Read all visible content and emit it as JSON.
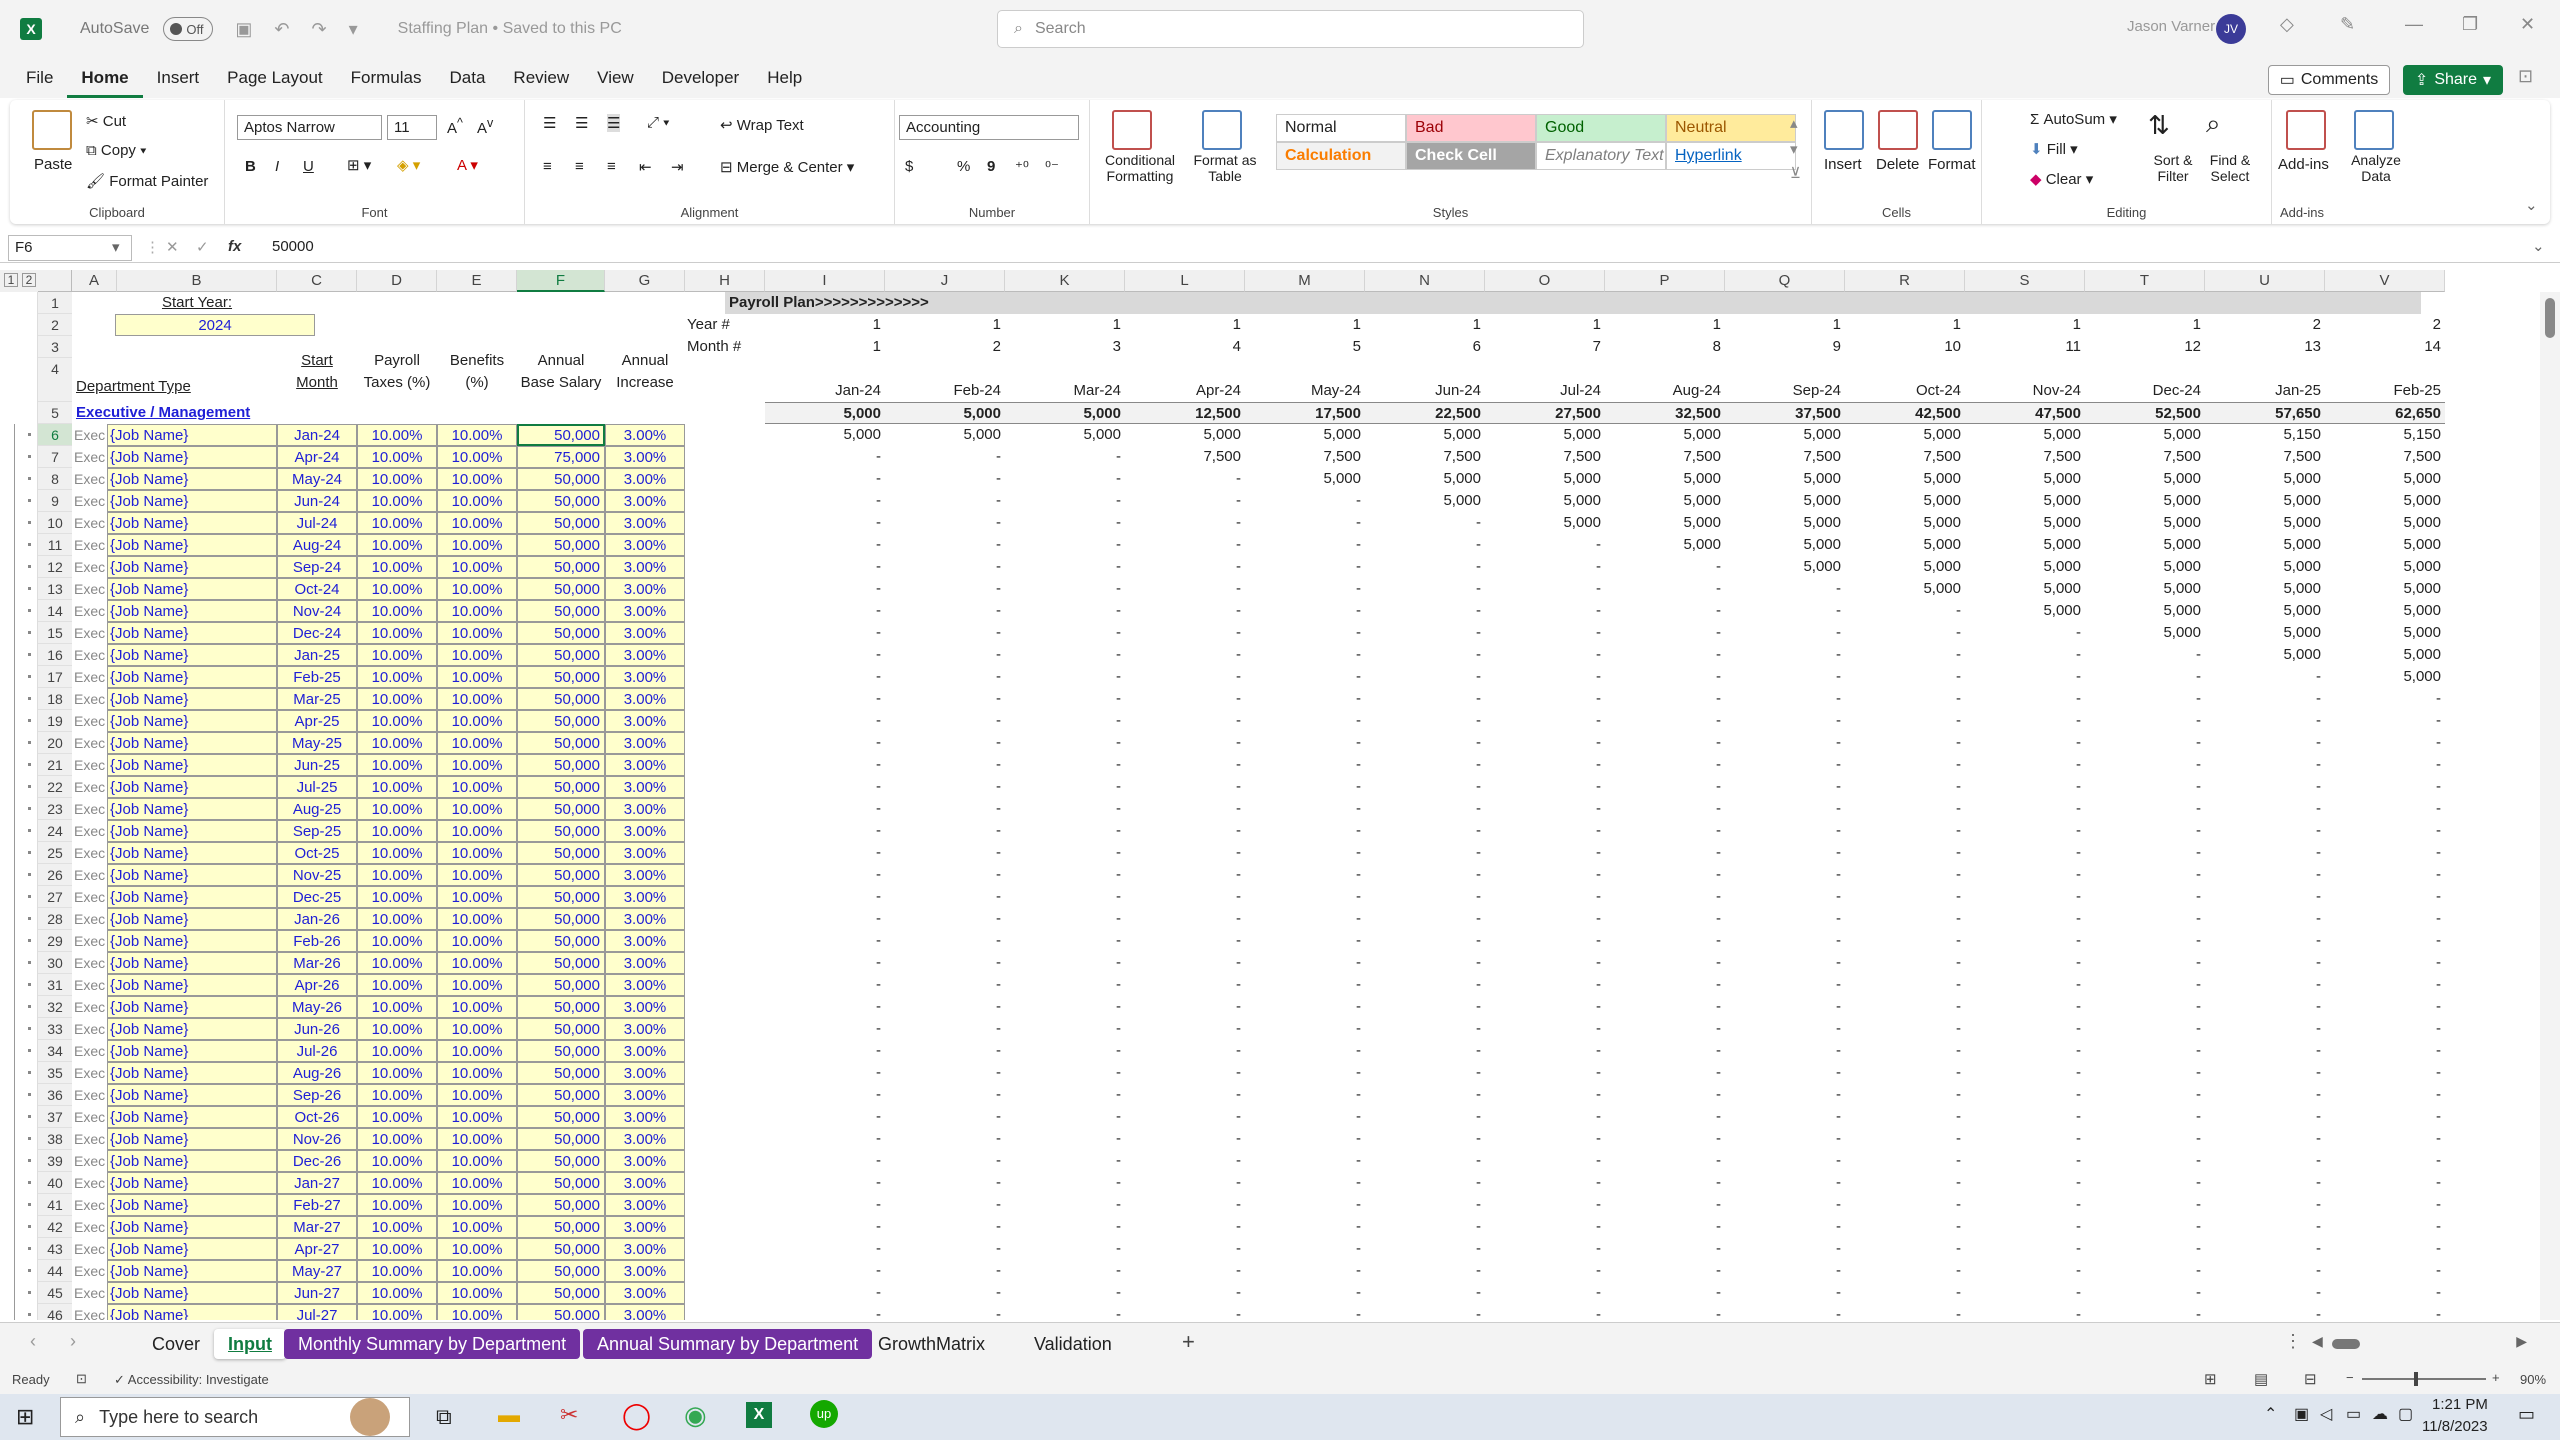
{
  "titlebar": {
    "autosave_label": "AutoSave",
    "autosave_state": "Off",
    "doc_title": "Staffing Plan • Saved to this PC",
    "search_placeholder": "Search",
    "user_name": "Jason Varner",
    "user_initials": "JV"
  },
  "menu": {
    "tabs": [
      "File",
      "Home",
      "Insert",
      "Page Layout",
      "Formulas",
      "Data",
      "Review",
      "View",
      "Developer",
      "Help"
    ],
    "active": "Home",
    "comments": "Comments",
    "share": "Share"
  },
  "ribbon": {
    "clipboard": {
      "label": "Clipboard",
      "paste": "Paste",
      "cut": "Cut",
      "copy": "Copy",
      "format_painter": "Format Painter"
    },
    "font": {
      "label": "Font",
      "name": "Aptos Narrow",
      "size": "11",
      "bold": "B",
      "italic": "I",
      "underline": "U"
    },
    "alignment": {
      "label": "Alignment",
      "wrap": "Wrap Text",
      "merge": "Merge & Center"
    },
    "number": {
      "label": "Number",
      "format": "Accounting",
      "currency": "$",
      "percent": "%",
      "comma": "9"
    },
    "styles": {
      "label": "Styles",
      "conditional": "Conditional Formatting",
      "format_table": "Format as Table",
      "cells": [
        {
          "name": "Normal",
          "bg": "#ffffff",
          "fg": "#222222"
        },
        {
          "name": "Bad",
          "bg": "#ffc7ce",
          "fg": "#9c0006"
        },
        {
          "name": "Good",
          "bg": "#c6efce",
          "fg": "#006100"
        },
        {
          "name": "Neutral",
          "bg": "#ffeb9c",
          "fg": "#9c5700"
        },
        {
          "name": "Calculation",
          "bg": "#f2f2f2",
          "fg": "#fa7d00"
        },
        {
          "name": "Check Cell",
          "bg": "#a5a5a5",
          "fg": "#ffffff"
        },
        {
          "name": "Explanatory Text",
          "bg": "#ffffff",
          "fg": "#7f7f7f"
        },
        {
          "name": "Hyperlink",
          "bg": "#ffffff",
          "fg": "#0563c1"
        }
      ]
    },
    "cells": {
      "label": "Cells",
      "insert": "Insert",
      "delete": "Delete",
      "format": "Format"
    },
    "editing": {
      "label": "Editing",
      "autosum": "AutoSum",
      "fill": "Fill",
      "clear": "Clear",
      "sort": "Sort & Filter",
      "find": "Find & Select"
    },
    "addins": {
      "label": "Add-ins",
      "addins": "Add-ins",
      "analyze": "Analyze Data"
    }
  },
  "formula_bar": {
    "name_box": "F6",
    "fx": "fx",
    "value": "50000"
  },
  "grid": {
    "columns": [
      "A",
      "B",
      "C",
      "D",
      "E",
      "F",
      "G",
      "H",
      "I",
      "J",
      "K",
      "L",
      "M",
      "N",
      "O",
      "P",
      "Q",
      "R",
      "S",
      "T",
      "U",
      "V"
    ],
    "start_year_label": "Start Year:",
    "start_year": "2024",
    "header_dept": "Department Type",
    "header_start": "Start",
    "header_month": "Month",
    "header_payroll": "Payroll",
    "header_taxes": "Taxes (%)",
    "header_benefits": "Benefits",
    "header_benefits2": "(%)",
    "header_annual": "Annual",
    "header_base": "Base Salary",
    "header_annual2": "Annual",
    "header_increase": "Increase",
    "payroll_plan": "Payroll Plan>>>>>>>>>>>>>",
    "year_label": "Year #",
    "month_label": "Month #",
    "year_nums": [
      "1",
      "1",
      "1",
      "1",
      "1",
      "1",
      "1",
      "1",
      "1",
      "1",
      "1",
      "1",
      "2",
      "2"
    ],
    "month_nums": [
      "1",
      "2",
      "3",
      "4",
      "5",
      "6",
      "7",
      "8",
      "9",
      "10",
      "11",
      "12",
      "13",
      "14"
    ],
    "month_dates": [
      "Jan-24",
      "Feb-24",
      "Mar-24",
      "Apr-24",
      "May-24",
      "Jun-24",
      "Jul-24",
      "Aug-24",
      "Sep-24",
      "Oct-24",
      "Nov-24",
      "Dec-24",
      "Jan-25",
      "Feb-25"
    ],
    "section": "Executive / Management",
    "totals": [
      "5,000",
      "5,000",
      "5,000",
      "12,500",
      "17,500",
      "22,500",
      "27,500",
      "32,500",
      "37,500",
      "42,500",
      "47,500",
      "52,500",
      "57,650",
      "62,650"
    ],
    "row_prefix": "Exec",
    "job_name": "{Job Name}",
    "payroll_tax": "10.00%",
    "benefits": "10.00%",
    "increase": "3.00%",
    "start_months": [
      "Jan-24",
      "Apr-24",
      "May-24",
      "Jun-24",
      "Jul-24",
      "Aug-24",
      "Sep-24",
      "Oct-24",
      "Nov-24",
      "Dec-24",
      "Jan-25",
      "Feb-25",
      "Mar-25",
      "Apr-25",
      "May-25",
      "Jun-25",
      "Jul-25",
      "Aug-25",
      "Sep-25",
      "Oct-25",
      "Nov-25",
      "Dec-25",
      "Jan-26",
      "Feb-26",
      "Mar-26",
      "Apr-26",
      "May-26",
      "Jun-26",
      "Jul-26",
      "Aug-26",
      "Sep-26",
      "Oct-26",
      "Nov-26",
      "Dec-26",
      "Jan-27",
      "Feb-27",
      "Mar-27",
      "Apr-27",
      "May-27",
      "Jun-27",
      "Jul-27"
    ],
    "salaries": [
      "50,000",
      "75,000",
      "50,000",
      "50,000",
      "50,000",
      "50,000",
      "50,000",
      "50,000",
      "50,000",
      "50,000",
      "50,000",
      "50,000",
      "50,000",
      "50,000",
      "50,000",
      "50,000",
      "50,000",
      "50,000",
      "50,000",
      "50,000",
      "50,000",
      "50,000",
      "50,000",
      "50,000",
      "50,000",
      "50,000",
      "50,000",
      "50,000",
      "50,000",
      "50,000",
      "50,000",
      "50,000",
      "50,000",
      "50,000",
      "50,000",
      "50,000",
      "50,000",
      "50,000",
      "50,000",
      "50,000",
      "50,000"
    ],
    "row_numbers": [
      "1",
      "2",
      "3",
      "4",
      "5",
      "6",
      "7",
      "8",
      "9",
      "10",
      "11",
      "12",
      "13",
      "14",
      "15",
      "16",
      "17",
      "18",
      "19",
      "20",
      "21",
      "22",
      "23",
      "24",
      "25",
      "26",
      "27",
      "28",
      "29",
      "30",
      "31",
      "32",
      "33",
      "34",
      "35",
      "36",
      "37",
      "38",
      "39",
      "40",
      "41",
      "42",
      "43",
      "44",
      "45",
      "46"
    ],
    "dash": "-",
    "payroll_rows": [
      [
        "5,000",
        "5,000",
        "5,000",
        "5,000",
        "5,000",
        "5,000",
        "5,000",
        "5,000",
        "5,000",
        "5,000",
        "5,000",
        "5,000",
        "5,150",
        "5,150"
      ],
      [
        "-",
        "-",
        "-",
        "7,500",
        "7,500",
        "7,500",
        "7,500",
        "7,500",
        "7,500",
        "7,500",
        "7,500",
        "7,500",
        "7,500",
        "7,500"
      ],
      [
        "-",
        "-",
        "-",
        "-",
        "5,000",
        "5,000",
        "5,000",
        "5,000",
        "5,000",
        "5,000",
        "5,000",
        "5,000",
        "5,000",
        "5,000"
      ],
      [
        "-",
        "-",
        "-",
        "-",
        "-",
        "5,000",
        "5,000",
        "5,000",
        "5,000",
        "5,000",
        "5,000",
        "5,000",
        "5,000",
        "5,000"
      ],
      [
        "-",
        "-",
        "-",
        "-",
        "-",
        "-",
        "5,000",
        "5,000",
        "5,000",
        "5,000",
        "5,000",
        "5,000",
        "5,000",
        "5,000"
      ],
      [
        "-",
        "-",
        "-",
        "-",
        "-",
        "-",
        "-",
        "5,000",
        "5,000",
        "5,000",
        "5,000",
        "5,000",
        "5,000",
        "5,000"
      ],
      [
        "-",
        "-",
        "-",
        "-",
        "-",
        "-",
        "-",
        "-",
        "5,000",
        "5,000",
        "5,000",
        "5,000",
        "5,000",
        "5,000"
      ],
      [
        "-",
        "-",
        "-",
        "-",
        "-",
        "-",
        "-",
        "-",
        "-",
        "5,000",
        "5,000",
        "5,000",
        "5,000",
        "5,000"
      ],
      [
        "-",
        "-",
        "-",
        "-",
        "-",
        "-",
        "-",
        "-",
        "-",
        "-",
        "5,000",
        "5,000",
        "5,000",
        "5,000"
      ],
      [
        "-",
        "-",
        "-",
        "-",
        "-",
        "-",
        "-",
        "-",
        "-",
        "-",
        "-",
        "5,000",
        "5,000",
        "5,000"
      ],
      [
        "-",
        "-",
        "-",
        "-",
        "-",
        "-",
        "-",
        "-",
        "-",
        "-",
        "-",
        "-",
        "5,000",
        "5,000"
      ],
      [
        "-",
        "-",
        "-",
        "-",
        "-",
        "-",
        "-",
        "-",
        "-",
        "-",
        "-",
        "-",
        "-",
        "5,000"
      ]
    ]
  },
  "sheet_tabs": [
    {
      "name": "Cover",
      "bg": "",
      "fg": "#222222"
    },
    {
      "name": "Input",
      "bg": "#ffffff",
      "fg": "#107c41"
    },
    {
      "name": "Monthly Summary by Department",
      "bg": "#7030a0",
      "fg": "#ffffff"
    },
    {
      "name": "Annual Summary by Department",
      "bg": "#7030a0",
      "fg": "#ffffff"
    },
    {
      "name": "GrowthMatrix",
      "bg": "",
      "fg": "#222222"
    },
    {
      "name": "Validation",
      "bg": "",
      "fg": "#222222"
    }
  ],
  "status": {
    "ready": "Ready",
    "accessibility": "Accessibility: Investigate",
    "zoom": "90%"
  },
  "taskbar": {
    "search": "Type here to search",
    "time": "1:21 PM",
    "date": "11/8/2023"
  },
  "colors": {
    "accent": "#107c41",
    "input_bg": "#ffffcc",
    "input_fg": "#1f1fd6",
    "section_fg": "#1f1fd6"
  }
}
